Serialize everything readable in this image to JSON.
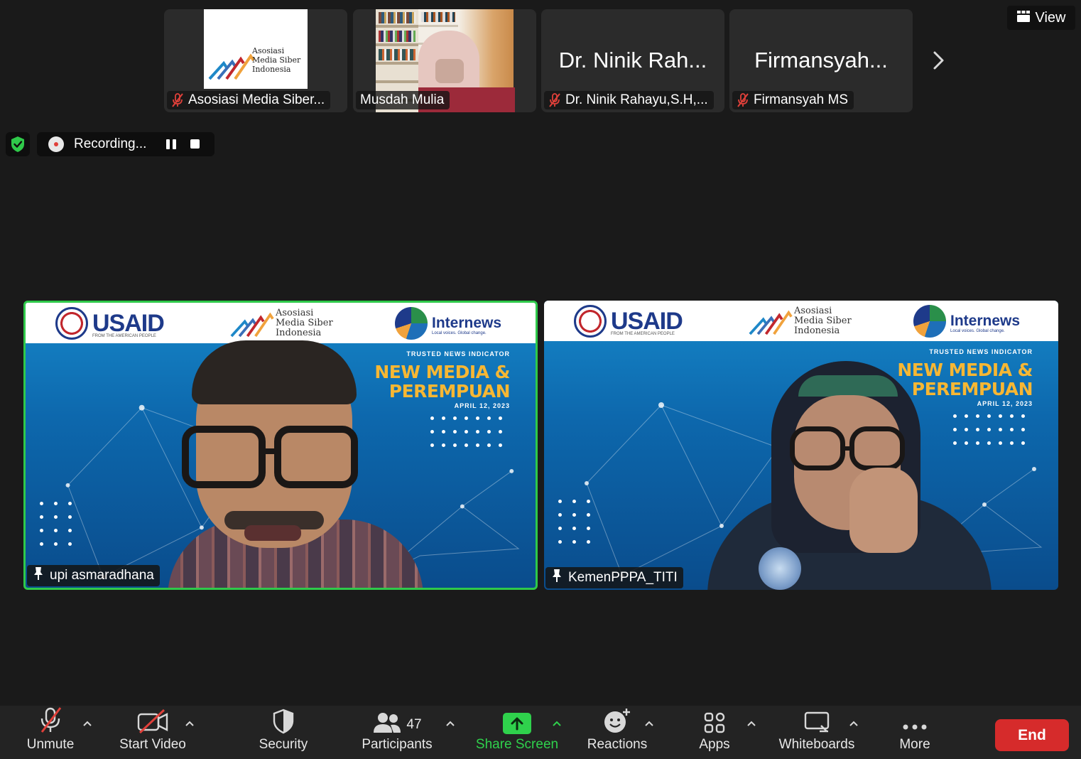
{
  "top_strip": {
    "participants": [
      {
        "name": "Asosiasi Media Siber...",
        "logo_text": [
          "Asosiasi",
          "Media Siber",
          "Indonesia"
        ],
        "muted": true
      },
      {
        "name": "Musdah Mulia",
        "muted": false
      },
      {
        "name": "Dr. Ninik Rahayu,S.H,...",
        "big_name": "Dr. Ninik Rah...",
        "muted": true
      },
      {
        "name": "Firmansyah MS",
        "big_name": "Firmansyah...",
        "muted": true
      }
    ],
    "view_label": "View"
  },
  "recording": {
    "label": "Recording..."
  },
  "tiles": [
    {
      "name": "upi asmaradhana",
      "active": true,
      "banner": {
        "usaid": "USAID",
        "usaid_sub": "FROM THE AMERICAN PEOPLE",
        "amsi": [
          "Asosiasi",
          "Media Siber",
          "Indonesia"
        ],
        "internews": "Internews",
        "internews_sub": "Local voices. Global change.",
        "trusted": "TRUSTED NEWS INDICATOR",
        "headline_1": "NEW MEDIA &",
        "headline_2": "PEREMPUAN",
        "date": "APRIL 12, 2023"
      }
    },
    {
      "name": "KemenPPPA_TITI",
      "active": false,
      "banner": {
        "usaid": "USAID",
        "usaid_sub": "FROM THE AMERICAN PEOPLE",
        "amsi": [
          "Asosiasi",
          "Media Siber",
          "Indonesia"
        ],
        "internews": "Internews",
        "internews_sub": "Local voices. Global change.",
        "trusted": "TRUSTED NEWS INDICATOR",
        "headline_1": "NEW MEDIA &",
        "headline_2": "PEREMPUAN",
        "date": "APRIL 12, 2023"
      }
    }
  ],
  "toolbar": {
    "unmute": "Unmute",
    "start_video": "Start Video",
    "security": "Security",
    "participants": "Participants",
    "participants_count": "47",
    "share_screen": "Share Screen",
    "reactions": "Reactions",
    "apps": "Apps",
    "whiteboards": "Whiteboards",
    "more": "More",
    "end": "End"
  },
  "colors": {
    "active_speaker_border": "#2fc94a",
    "share_screen_green": "#2fd14c",
    "end_red": "#d62b2b",
    "muted_red": "#e0403a"
  }
}
